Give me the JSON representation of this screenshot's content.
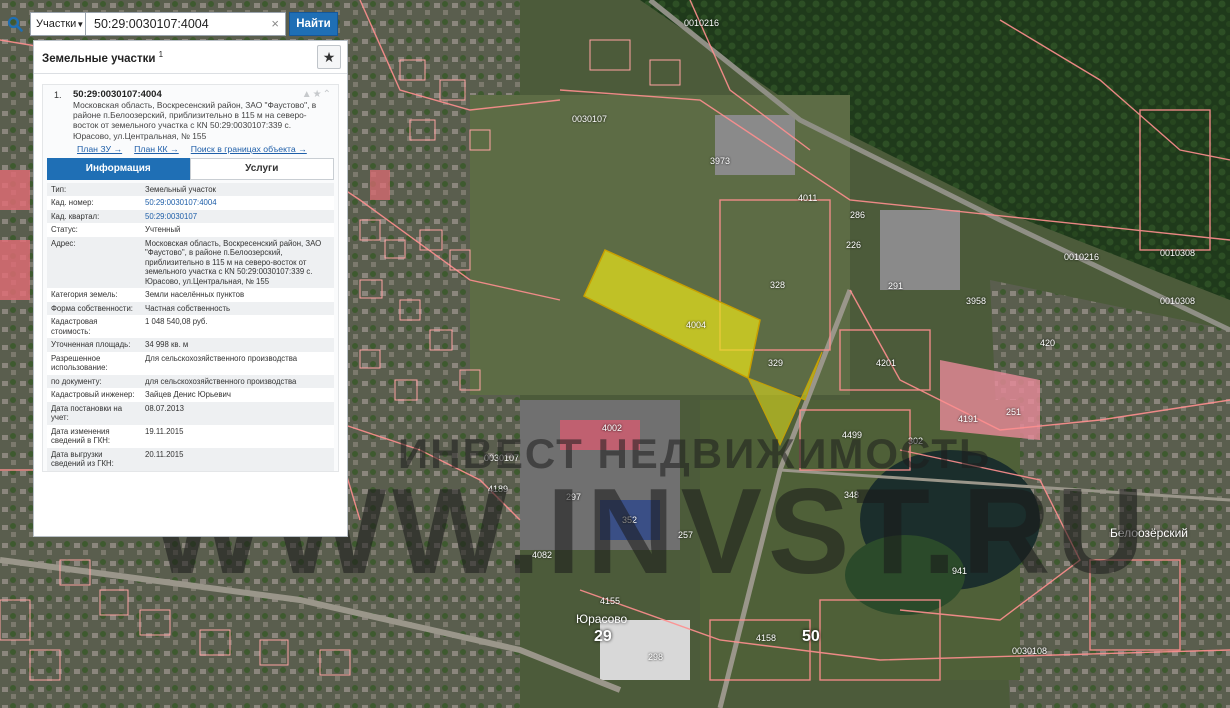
{
  "search": {
    "category": "Участки",
    "query": "50:29:0030107:4004",
    "find_label": "Найти"
  },
  "panel": {
    "title": "Земельные участки",
    "count": "1",
    "result": {
      "index": "1.",
      "cad_number": "50:29:0030107:4004",
      "address": "Московская область, Воскресенский район, ЗАО \"Фаустово\", в районе п.Белоозерский, приблизительно в 115 м на северо-восток от земельного участка с КN 50:29:0030107:339 с. Юрасово, ул.Центральная, № 155",
      "links": [
        "План ЗУ →",
        "План КК →",
        "Поиск в границах объекта →"
      ]
    },
    "tabs": [
      "Информация",
      "Услуги"
    ],
    "info": [
      {
        "k": "Тип:",
        "v": "Земельный участок"
      },
      {
        "k": "Кад. номер:",
        "v": "50:29:0030107:4004"
      },
      {
        "k": "Кад. квартал:",
        "v": "50:29:0030107"
      },
      {
        "k": "Статус:",
        "v": "Учтенный"
      },
      {
        "k": "Адрес:",
        "v": "Московская область, Воскресенский район, ЗАО \"Фаустово\", в районе п.Белоозерский, приблизительно в 115 м на северо-восток от земельного участка с КN 50:29:0030107:339 с. Юрасово, ул.Центральная, № 155"
      },
      {
        "k": "Категория земель:",
        "v": "Земли населённых пунктов"
      },
      {
        "k": "Форма собственности:",
        "v": "Частная собственность"
      },
      {
        "k": "Кадастровая стоимость:",
        "v": "1 048 540,08 руб."
      },
      {
        "k": "Уточненная площадь:",
        "v": "34 998 кв. м"
      },
      {
        "k": "Разрешенное использование:",
        "v": "Для сельскохозяйственного производства"
      },
      {
        "k": "по документу:",
        "v": "для сельскохозяйственного производства"
      },
      {
        "k": "Кадастровый инженер:",
        "v": "Зайцев Денис Юрьевич"
      },
      {
        "k": "Дата постановки на учет:",
        "v": "08.07.2013"
      },
      {
        "k": "Дата изменения сведений в ГКН:",
        "v": "19.11.2015"
      },
      {
        "k": "Дата выгрузки сведений из ГКН:",
        "v": "20.11.2015"
      }
    ]
  },
  "map": {
    "selected_parcel": "4004",
    "places": [
      "Юрасово",
      "Белоозёрский"
    ],
    "quarters": [
      "0030107",
      "0030107",
      "0010216",
      "0010216",
      "0030108",
      "0010308",
      "0010308"
    ],
    "big_numbers": [
      "29",
      "50"
    ],
    "parcel_labels": [
      "328",
      "329",
      "4201",
      "4191",
      "4499",
      "348",
      "4002",
      "4189",
      "297",
      "352",
      "257",
      "4082",
      "4158",
      "298",
      "3973",
      "4011",
      "291",
      "3958",
      "420",
      "4155",
      "941",
      "302",
      "251",
      "286",
      "226"
    ]
  },
  "watermark": {
    "line1": "ИНВЕСТ НЕДВИЖИМОСТЬ",
    "line2": "WWW.INVST.RU"
  },
  "colors": {
    "accent": "#1f6fb5",
    "parcel_fill": "#e6e21a",
    "boundary": "#ff8080"
  }
}
